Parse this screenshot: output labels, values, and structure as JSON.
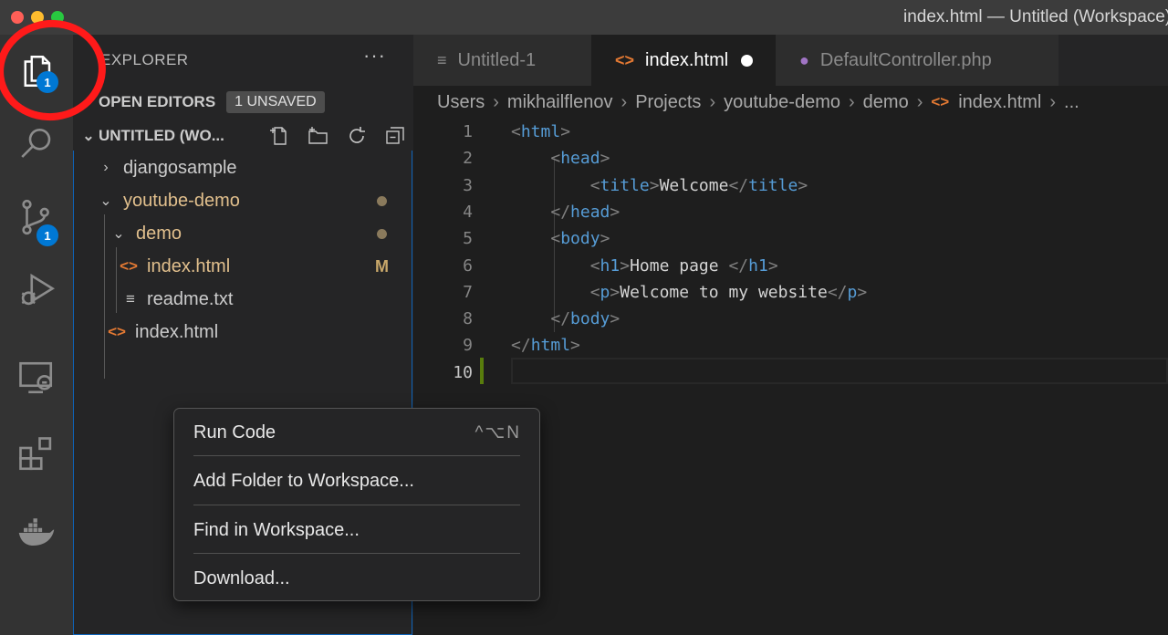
{
  "window": {
    "title": "index.html — Untitled (Workspace)"
  },
  "activity_bar": {
    "items": [
      {
        "name": "explorer",
        "icon": "files-icon",
        "badge": "1"
      },
      {
        "name": "search",
        "icon": "search-icon"
      },
      {
        "name": "source-control",
        "icon": "source-control-icon",
        "badge": "1"
      },
      {
        "name": "run-debug",
        "icon": "run-debug-icon"
      },
      {
        "name": "remote-explorer",
        "icon": "remote-explorer-icon"
      },
      {
        "name": "extensions",
        "icon": "extensions-icon"
      },
      {
        "name": "docker",
        "icon": "docker-icon"
      }
    ],
    "annotation_color": "#ff1a1a"
  },
  "explorer": {
    "title": "EXPLORER",
    "more": "···",
    "open_editors": {
      "label": "OPEN EDITORS",
      "badge": "1 UNSAVED"
    },
    "workspace": {
      "label": "UNTITLED (WO..."
    },
    "tree": [
      {
        "label": "djangosample",
        "type": "folder",
        "expanded": false
      },
      {
        "label": "youtube-demo",
        "type": "folder",
        "expanded": true,
        "modified": true
      },
      {
        "label": "demo",
        "type": "folder",
        "expanded": true,
        "modified": true
      },
      {
        "label": "index.html",
        "type": "html",
        "status": "M"
      },
      {
        "label": "readme.txt",
        "type": "text"
      },
      {
        "label": "index.html",
        "type": "html"
      }
    ]
  },
  "tabs": [
    {
      "label": "Untitled-1",
      "icon": "text-file-icon",
      "active": false
    },
    {
      "label": "index.html",
      "icon": "html-file-icon",
      "active": true,
      "dirty": true
    },
    {
      "label": "DefaultController.php",
      "icon": "php-file-icon",
      "active": false
    }
  ],
  "breadcrumb": [
    "Users",
    "mikhailflenov",
    "Projects",
    "youtube-demo",
    "demo",
    "index.html",
    "..."
  ],
  "code": {
    "line_numbers": [
      "1",
      "2",
      "3",
      "4",
      "5",
      "6",
      "7",
      "8",
      "9",
      "10"
    ],
    "lines": [
      {
        "indent": "",
        "open": "<",
        "tag": "html",
        "close": ">",
        "text": "",
        "open2": "",
        "tag2": "",
        "close2": ""
      },
      {
        "indent": "    ",
        "open": "<",
        "tag": "head",
        "close": ">",
        "text": "",
        "open2": "",
        "tag2": "",
        "close2": ""
      },
      {
        "indent": "        ",
        "open": "<",
        "tag": "title",
        "close": ">",
        "text": "Welcome",
        "open2": "</",
        "tag2": "title",
        "close2": ">"
      },
      {
        "indent": "    ",
        "open": "</",
        "tag": "head",
        "close": ">",
        "text": "",
        "open2": "",
        "tag2": "",
        "close2": ""
      },
      {
        "indent": "    ",
        "open": "<",
        "tag": "body",
        "close": ">",
        "text": "",
        "open2": "",
        "tag2": "",
        "close2": ""
      },
      {
        "indent": "        ",
        "open": "<",
        "tag": "h1",
        "close": ">",
        "text": "Home page ",
        "open2": "</",
        "tag2": "h1",
        "close2": ">"
      },
      {
        "indent": "        ",
        "open": "<",
        "tag": "p",
        "close": ">",
        "text": "Welcome to my website",
        "open2": "</",
        "tag2": "p",
        "close2": ">"
      },
      {
        "indent": "    ",
        "open": "</",
        "tag": "body",
        "close": ">",
        "text": "",
        "open2": "",
        "tag2": "",
        "close2": ""
      },
      {
        "indent": "",
        "open": "</",
        "tag": "html",
        "close": ">",
        "text": "",
        "open2": "",
        "tag2": "",
        "close2": ""
      },
      {
        "indent": "",
        "open": "",
        "tag": "",
        "close": "",
        "text": "",
        "open2": "",
        "tag2": "",
        "close2": ""
      }
    ]
  },
  "context_menu": {
    "items": [
      {
        "label": "Run Code",
        "shortcut": "^⌥N"
      },
      {
        "label": "Add Folder to Workspace...",
        "shortcut": ""
      },
      {
        "label": "Find in Workspace...",
        "shortcut": ""
      },
      {
        "label": "Download...",
        "shortcut": ""
      }
    ]
  }
}
